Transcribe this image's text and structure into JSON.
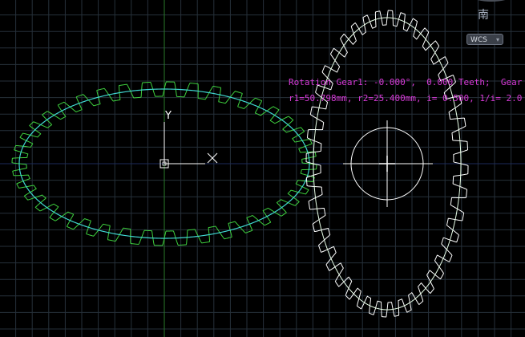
{
  "viewport": {
    "info_line1": "Rotation Gear1: -0.000°,  0.000 Teeth;  Gear",
    "info_line2": "r1=50.798mm, r2=25.400mm, i= 0.500, 1/i= 2.0",
    "axis_label_y": "Y",
    "axis_label_x": "X"
  },
  "viewcube": {
    "direction_label": "南",
    "coordinate_system": "WCS",
    "dropdown_icon": "chevron-down-icon"
  },
  "colors": {
    "background": "#000000",
    "grid": "#26303a",
    "grid_major": "#3a4450",
    "gear1_teeth": "#3ecf3e",
    "gear1_pitch": "#3fd6d0",
    "gear2_teeth": "#ffffff",
    "gear2_pitch": "#e8ffe8",
    "info_text": "#d83ad8",
    "axis_y_line": "#2a7a2a",
    "axis_x_line": "#7a2a2a"
  },
  "gears": {
    "gear1_tooth_count": 40,
    "gear2_tooth_count": 40
  }
}
